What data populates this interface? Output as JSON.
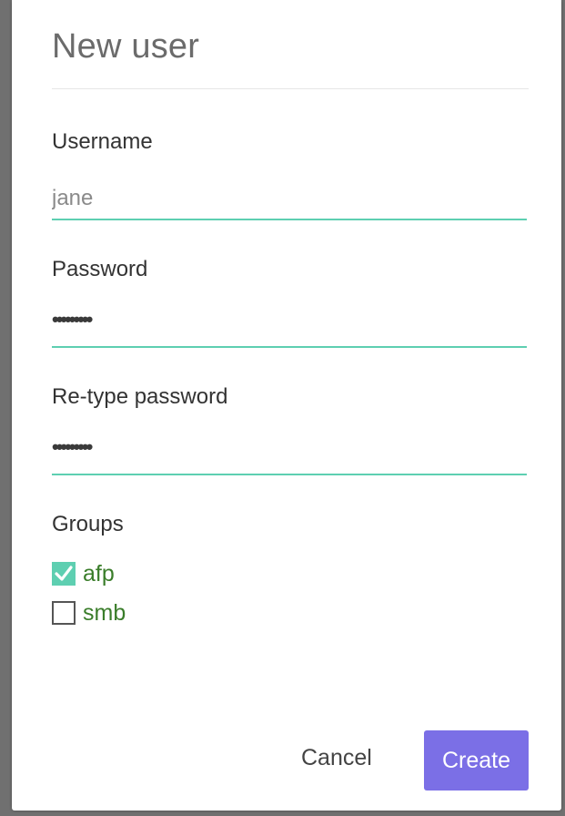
{
  "dialog": {
    "title": "New user"
  },
  "form": {
    "username": {
      "label": "Username",
      "value": "jane"
    },
    "password": {
      "label": "Password",
      "masked_value": "•••••••••"
    },
    "retype_password": {
      "label": "Re-type password",
      "masked_value": "•••••••••"
    },
    "groups": {
      "label": "Groups",
      "items": [
        {
          "label": "afp",
          "checked": true
        },
        {
          "label": "smb",
          "checked": false
        }
      ]
    }
  },
  "actions": {
    "cancel_label": "Cancel",
    "create_label": "Create"
  },
  "colors": {
    "accent": "#5ecfb1",
    "primary_button": "#7b6fe6",
    "group_label": "#3a7d2a"
  },
  "icons": {
    "checked": "check-icon"
  }
}
